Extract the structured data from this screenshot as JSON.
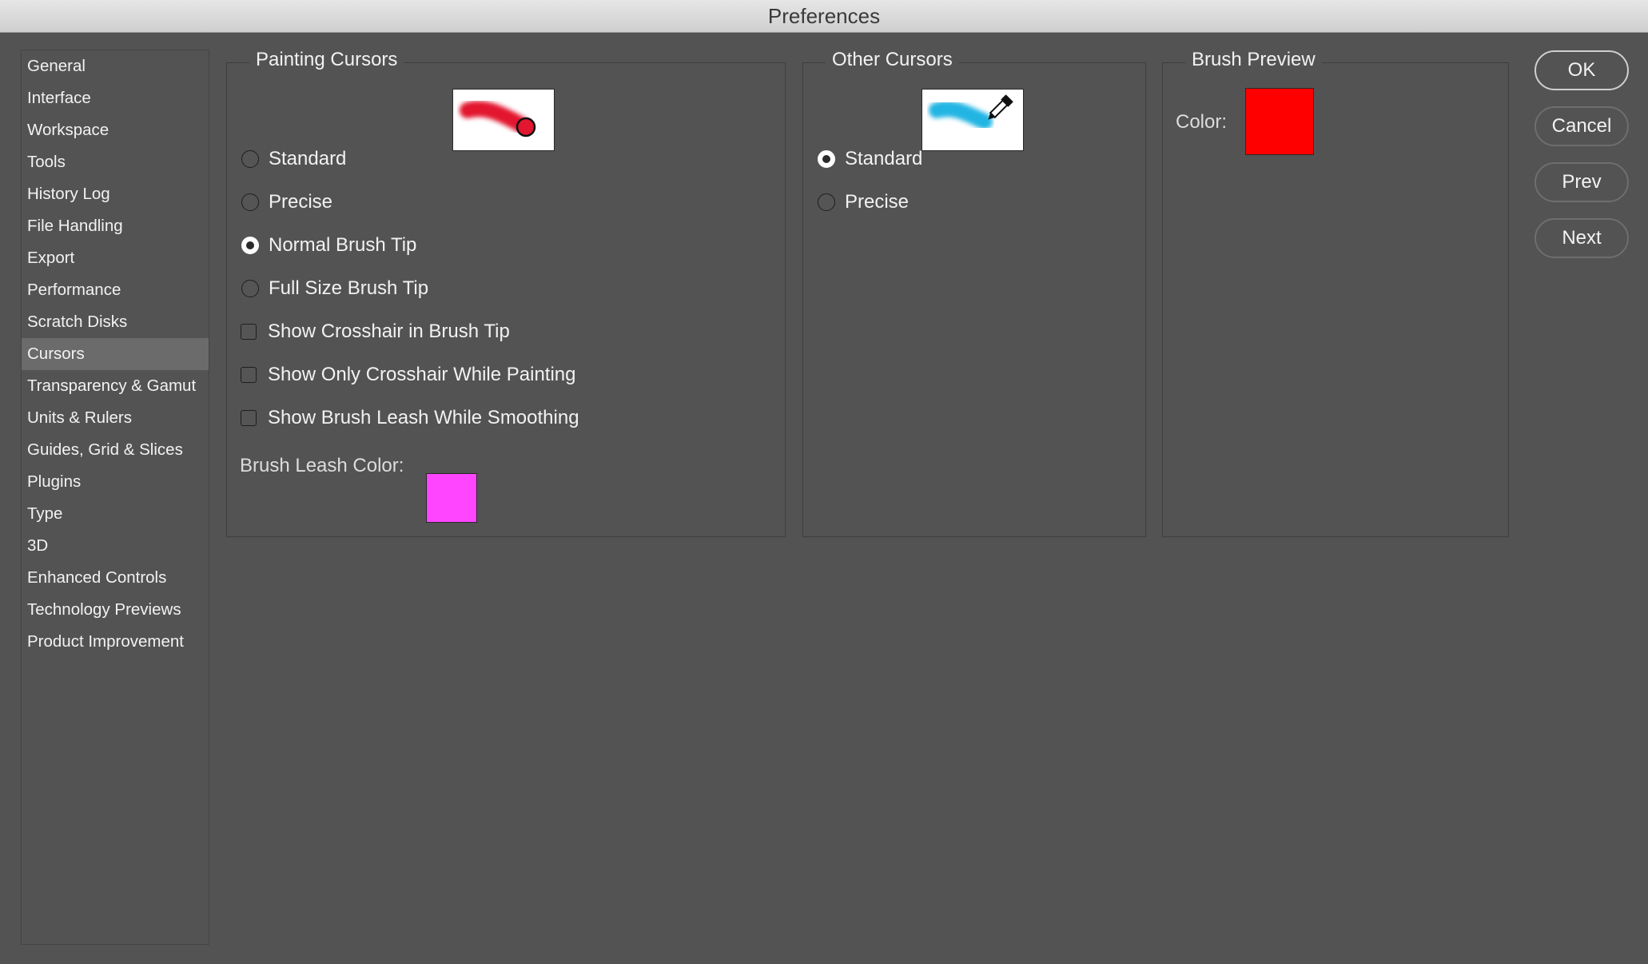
{
  "window": {
    "title": "Preferences"
  },
  "sidebar": {
    "items": [
      {
        "label": "General"
      },
      {
        "label": "Interface"
      },
      {
        "label": "Workspace"
      },
      {
        "label": "Tools"
      },
      {
        "label": "History Log"
      },
      {
        "label": "File Handling"
      },
      {
        "label": "Export"
      },
      {
        "label": "Performance"
      },
      {
        "label": "Scratch Disks"
      },
      {
        "label": "Cursors",
        "selected": true
      },
      {
        "label": "Transparency & Gamut"
      },
      {
        "label": "Units & Rulers"
      },
      {
        "label": "Guides, Grid & Slices"
      },
      {
        "label": "Plugins"
      },
      {
        "label": "Type"
      },
      {
        "label": "3D"
      },
      {
        "label": "Enhanced Controls"
      },
      {
        "label": "Technology Previews"
      },
      {
        "label": "Product Improvement"
      }
    ]
  },
  "painting_cursors": {
    "title": "Painting Cursors",
    "options": [
      {
        "label": "Standard",
        "checked": false
      },
      {
        "label": "Precise",
        "checked": false
      },
      {
        "label": "Normal Brush Tip",
        "checked": true
      },
      {
        "label": "Full Size Brush Tip",
        "checked": false
      }
    ],
    "checkboxes": [
      {
        "label": "Show Crosshair in Brush Tip",
        "checked": false
      },
      {
        "label": "Show Only Crosshair While Painting",
        "checked": false
      },
      {
        "label": "Show Brush Leash While Smoothing",
        "checked": false
      }
    ],
    "leash_color_label": "Brush Leash Color:",
    "leash_color": "#ff45ff"
  },
  "other_cursors": {
    "title": "Other Cursors",
    "options": [
      {
        "label": "Standard",
        "checked": true
      },
      {
        "label": "Precise",
        "checked": false
      }
    ]
  },
  "brush_preview": {
    "title": "Brush Preview",
    "color_label": "Color:",
    "color": "#ff0000"
  },
  "buttons": {
    "ok": "OK",
    "cancel": "Cancel",
    "prev": "Prev",
    "next": "Next"
  },
  "icons": {
    "painting_preview": "brush-stroke-icon",
    "other_preview": "eyedropper-icon"
  }
}
